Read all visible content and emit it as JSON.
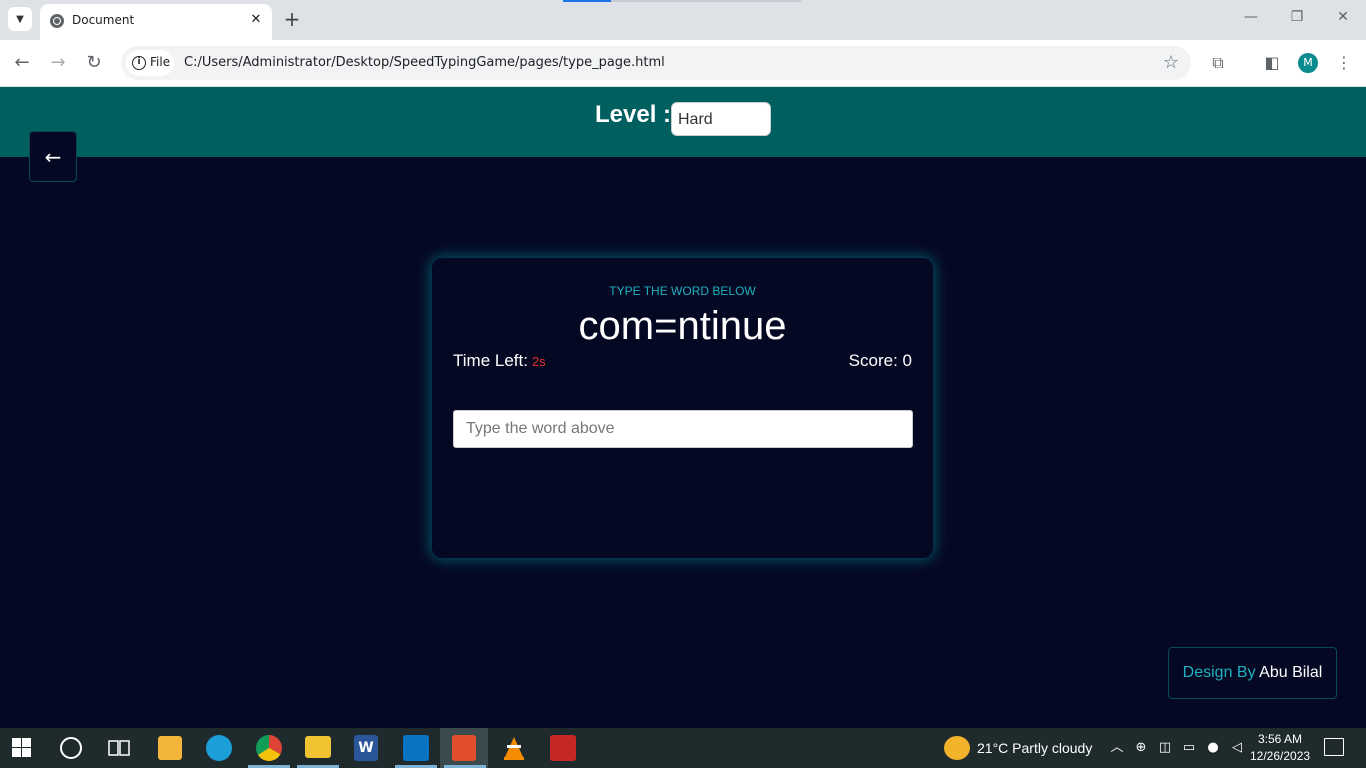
{
  "browser": {
    "tab_title": "Document",
    "tab_close": "✕",
    "new_tab": "+",
    "chip_label": "File",
    "url": "C:/Users/Administrator/Desktop/SpeedTypingGame/pages/type_page.html",
    "profile_initial": "M"
  },
  "header": {
    "level_label": "Level :",
    "level_selected": "Hard"
  },
  "back_button": {
    "icon": "←"
  },
  "game": {
    "instruction": "TYPE THE WORD BELOW",
    "word": "com=ntinue",
    "time_label": "Time Left:",
    "time_value": "2s",
    "score_label": "Score:",
    "score_value": "0",
    "input_placeholder": "Type the word above"
  },
  "credit": {
    "prefix": "Design By",
    "name": "Abu Bilal"
  },
  "taskbar": {
    "weather": "21°C  Partly cloudy",
    "time": "3:56 AM",
    "date": "12/26/2023"
  },
  "colors": {
    "header_bg": "#005f5f",
    "page_bg": "#050822",
    "accent": "#1fb0c0",
    "timer": "#e0302a"
  }
}
